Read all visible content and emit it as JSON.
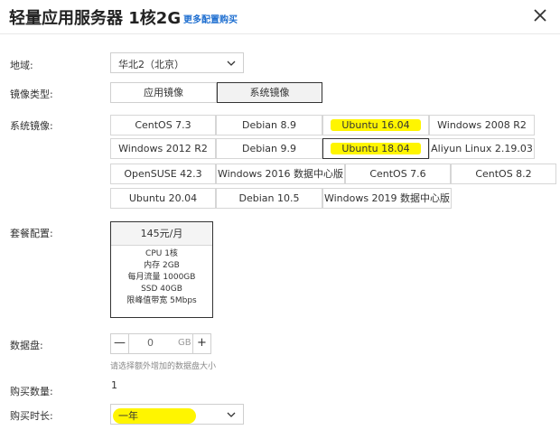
{
  "header": {
    "title": "轻量应用服务器 1核2G",
    "more_link": "更多配置购买"
  },
  "region": {
    "label": "地域:",
    "value": "华北2（北京）"
  },
  "image_type": {
    "label": "镜像类型:",
    "options": [
      "应用镜像",
      "系统镜像"
    ],
    "selected": "系统镜像"
  },
  "system_image": {
    "label": "系统镜像:",
    "options": [
      "CentOS 7.3",
      "Debian 8.9",
      "Ubuntu 16.04",
      "Windows 2008 R2",
      "Windows 2012 R2",
      "Debian 9.9",
      "Ubuntu 18.04",
      "Aliyun Linux 2.19.03",
      "OpenSUSE 42.3",
      "Windows 2016 数据中心版",
      "CentOS 7.6",
      "CentOS 8.2",
      "Ubuntu 20.04",
      "Debian 10.5",
      "Windows 2019 数据中心版"
    ],
    "selected": "Ubuntu 18.04",
    "highlighted": [
      "Ubuntu 16.04",
      "Ubuntu 18.04"
    ],
    "highlight_color": "#fff500"
  },
  "plan": {
    "label": "套餐配置:",
    "price": "145元/月",
    "specs": [
      "CPU 1核",
      "内存 2GB",
      "每月流量 1000GB",
      "SSD 40GB",
      "限峰值带宽 5Mbps"
    ]
  },
  "data_disk": {
    "label": "数据盘:",
    "value": "0",
    "unit": "GB",
    "minus": "—",
    "plus": "+",
    "hint": "请选择额外增加的数据盘大小"
  },
  "quantity": {
    "label": "购买数量:",
    "value": "1"
  },
  "duration": {
    "label": "购买时长:",
    "value": "一年"
  }
}
